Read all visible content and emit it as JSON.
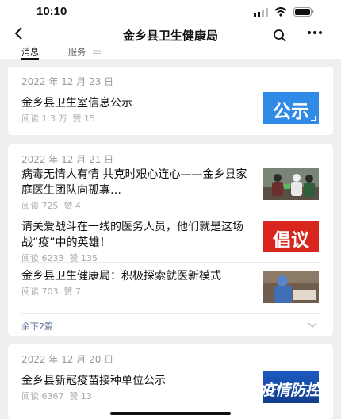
{
  "status_bar": {
    "time": "10:10"
  },
  "nav": {
    "title": "金乡县卫生健康局"
  },
  "tabs": [
    {
      "label": "消息"
    },
    {
      "label": "服务"
    }
  ],
  "groups": [
    {
      "date": "2022 年 12 月 23 日",
      "articles": [
        {
          "title": "金乡县卫生室信息公示",
          "reads": "阅读 1.3 万",
          "likes": "赞 15",
          "thumb_text": "公示"
        }
      ]
    },
    {
      "date": "2022 年 12 月 21 日",
      "articles": [
        {
          "title": "病毒无情人有情 共克时艰心连心——金乡县家庭医生团队向孤寡…",
          "reads": "阅读 725",
          "likes": "赞 4"
        },
        {
          "title": "请关爱战斗在一线的医务人员，他们就是这场战“疫”中的英雄！",
          "reads": "阅读 6233",
          "likes": "赞 135",
          "thumb_text": "倡议"
        },
        {
          "title": "金乡县卫生健康局：积极探索就医新模式",
          "reads": "阅读 703",
          "likes": "赞 7"
        }
      ],
      "more": "余下2篇"
    },
    {
      "date": "2022 年 12 月 20 日",
      "articles": [
        {
          "title": "金乡县新冠疫苗接种单位公示",
          "reads": "阅读 6367",
          "likes": "赞 13",
          "thumb_text": "疫情防控"
        }
      ]
    }
  ],
  "colors": {
    "accent": "#586b94",
    "gongshi_blue": "#2f8be6",
    "changyi_red": "#d9261c",
    "yiqing_blue": "#1b4fb0"
  }
}
